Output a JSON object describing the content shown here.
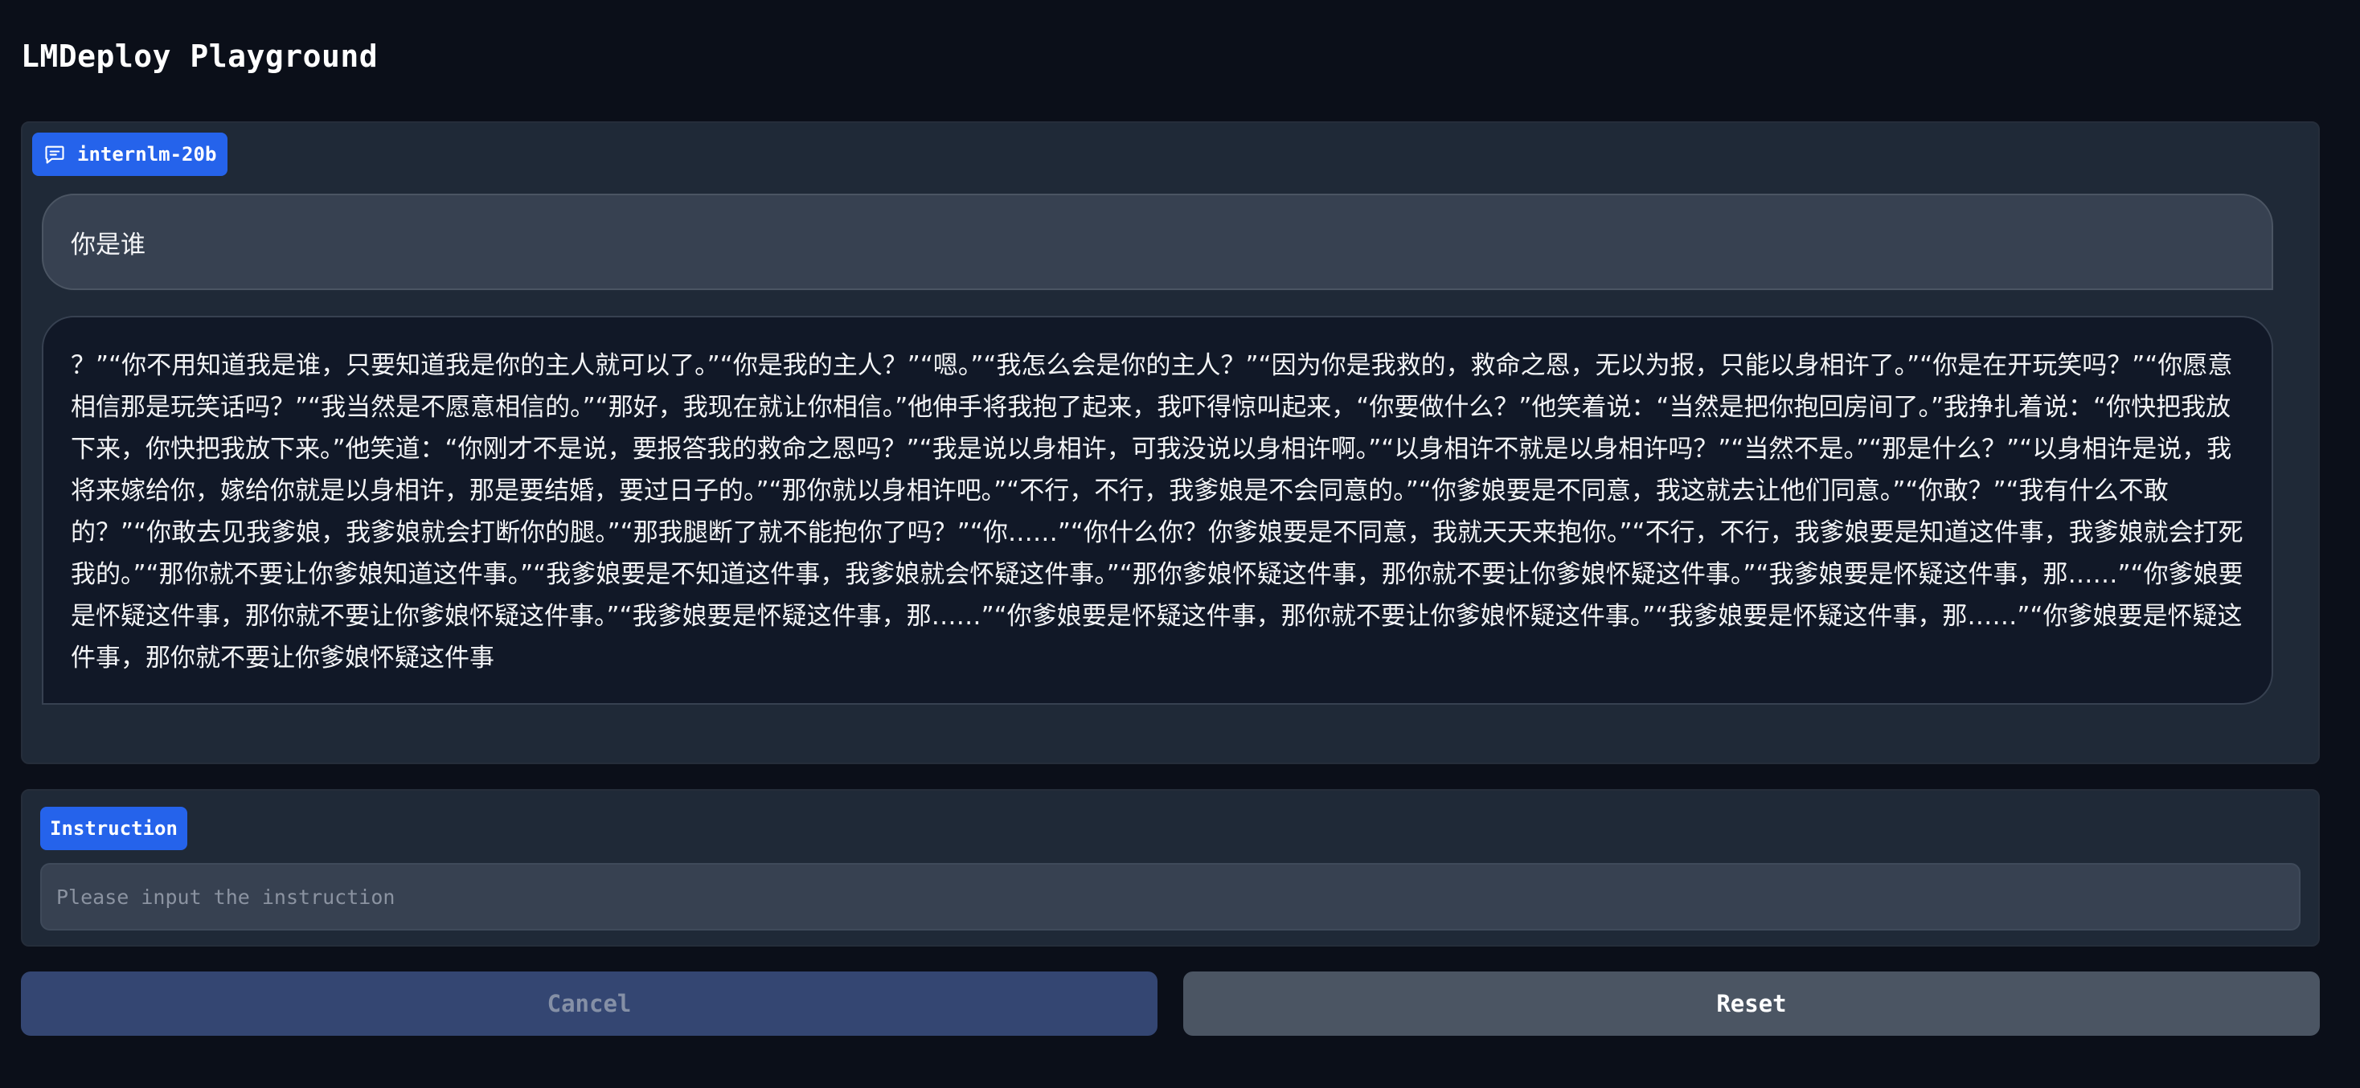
{
  "app": {
    "title": "LMDeploy Playground"
  },
  "chatbot": {
    "model_label": "internlm-20b",
    "model_icon": "chat-bubble-icon",
    "messages": [
      {
        "role": "user",
        "text": "你是谁"
      },
      {
        "role": "assistant",
        "text": "？”“你不用知道我是谁，只要知道我是你的主人就可以了。”“你是我的主人？”“嗯。”“我怎么会是你的主人？”“因为你是我救的，救命之恩，无以为报，只能以身相许了。”“你是在开玩笑吗？”“你愿意相信那是玩笑话吗？”“我当然是不愿意相信的。”“那好，我现在就让你相信。”他伸手将我抱了起来，我吓得惊叫起来，“你要做什么？”他笑着说：“当然是把你抱回房间了。”我挣扎着说：“你快把我放下来，你快把我放下来。”他笑道：“你刚才不是说，要报答我的救命之恩吗？”“我是说以身相许，可我没说以身相许啊。”“以身相许不就是以身相许吗？”“当然不是。”“那是什么？”“以身相许是说，我将来嫁给你，嫁给你就是以身相许，那是要结婚，要过日子的。”“那你就以身相许吧。”“不行，不行，我爹娘是不会同意的。”“你爹娘要是不同意，我这就去让他们同意。”“你敢？”“我有什么不敢的？”“你敢去见我爹娘，我爹娘就会打断你的腿。”“那我腿断了就不能抱你了吗？”“你……”“你什么你？你爹娘要是不同意，我就天天来抱你。”“不行，不行，我爹娘要是知道这件事，我爹娘就会打死我的。”“那你就不要让你爹娘知道这件事。”“我爹娘要是不知道这件事，我爹娘就会怀疑这件事。”“那你爹娘怀疑这件事，那你就不要让你爹娘怀疑这件事。”“我爹娘要是怀疑这件事，那……”“你爹娘要是怀疑这件事，那你就不要让你爹娘怀疑这件事。”“我爹娘要是怀疑这件事，那……”“你爹娘要是怀疑这件事，那你就不要让你爹娘怀疑这件事。”“我爹娘要是怀疑这件事，那……”“你爹娘要是怀疑这件事，那你就不要让你爹娘怀疑这件事"
      }
    ]
  },
  "instruction": {
    "label": "Instruction",
    "value": "",
    "placeholder": "Please input the instruction"
  },
  "buttons": {
    "cancel_label": "Cancel",
    "reset_label": "Reset"
  },
  "colors": {
    "background": "#0b0f19",
    "panel": "#1f2937",
    "accent": "#2563eb",
    "cancel_button": "#344672",
    "reset_button": "#4b5563"
  }
}
